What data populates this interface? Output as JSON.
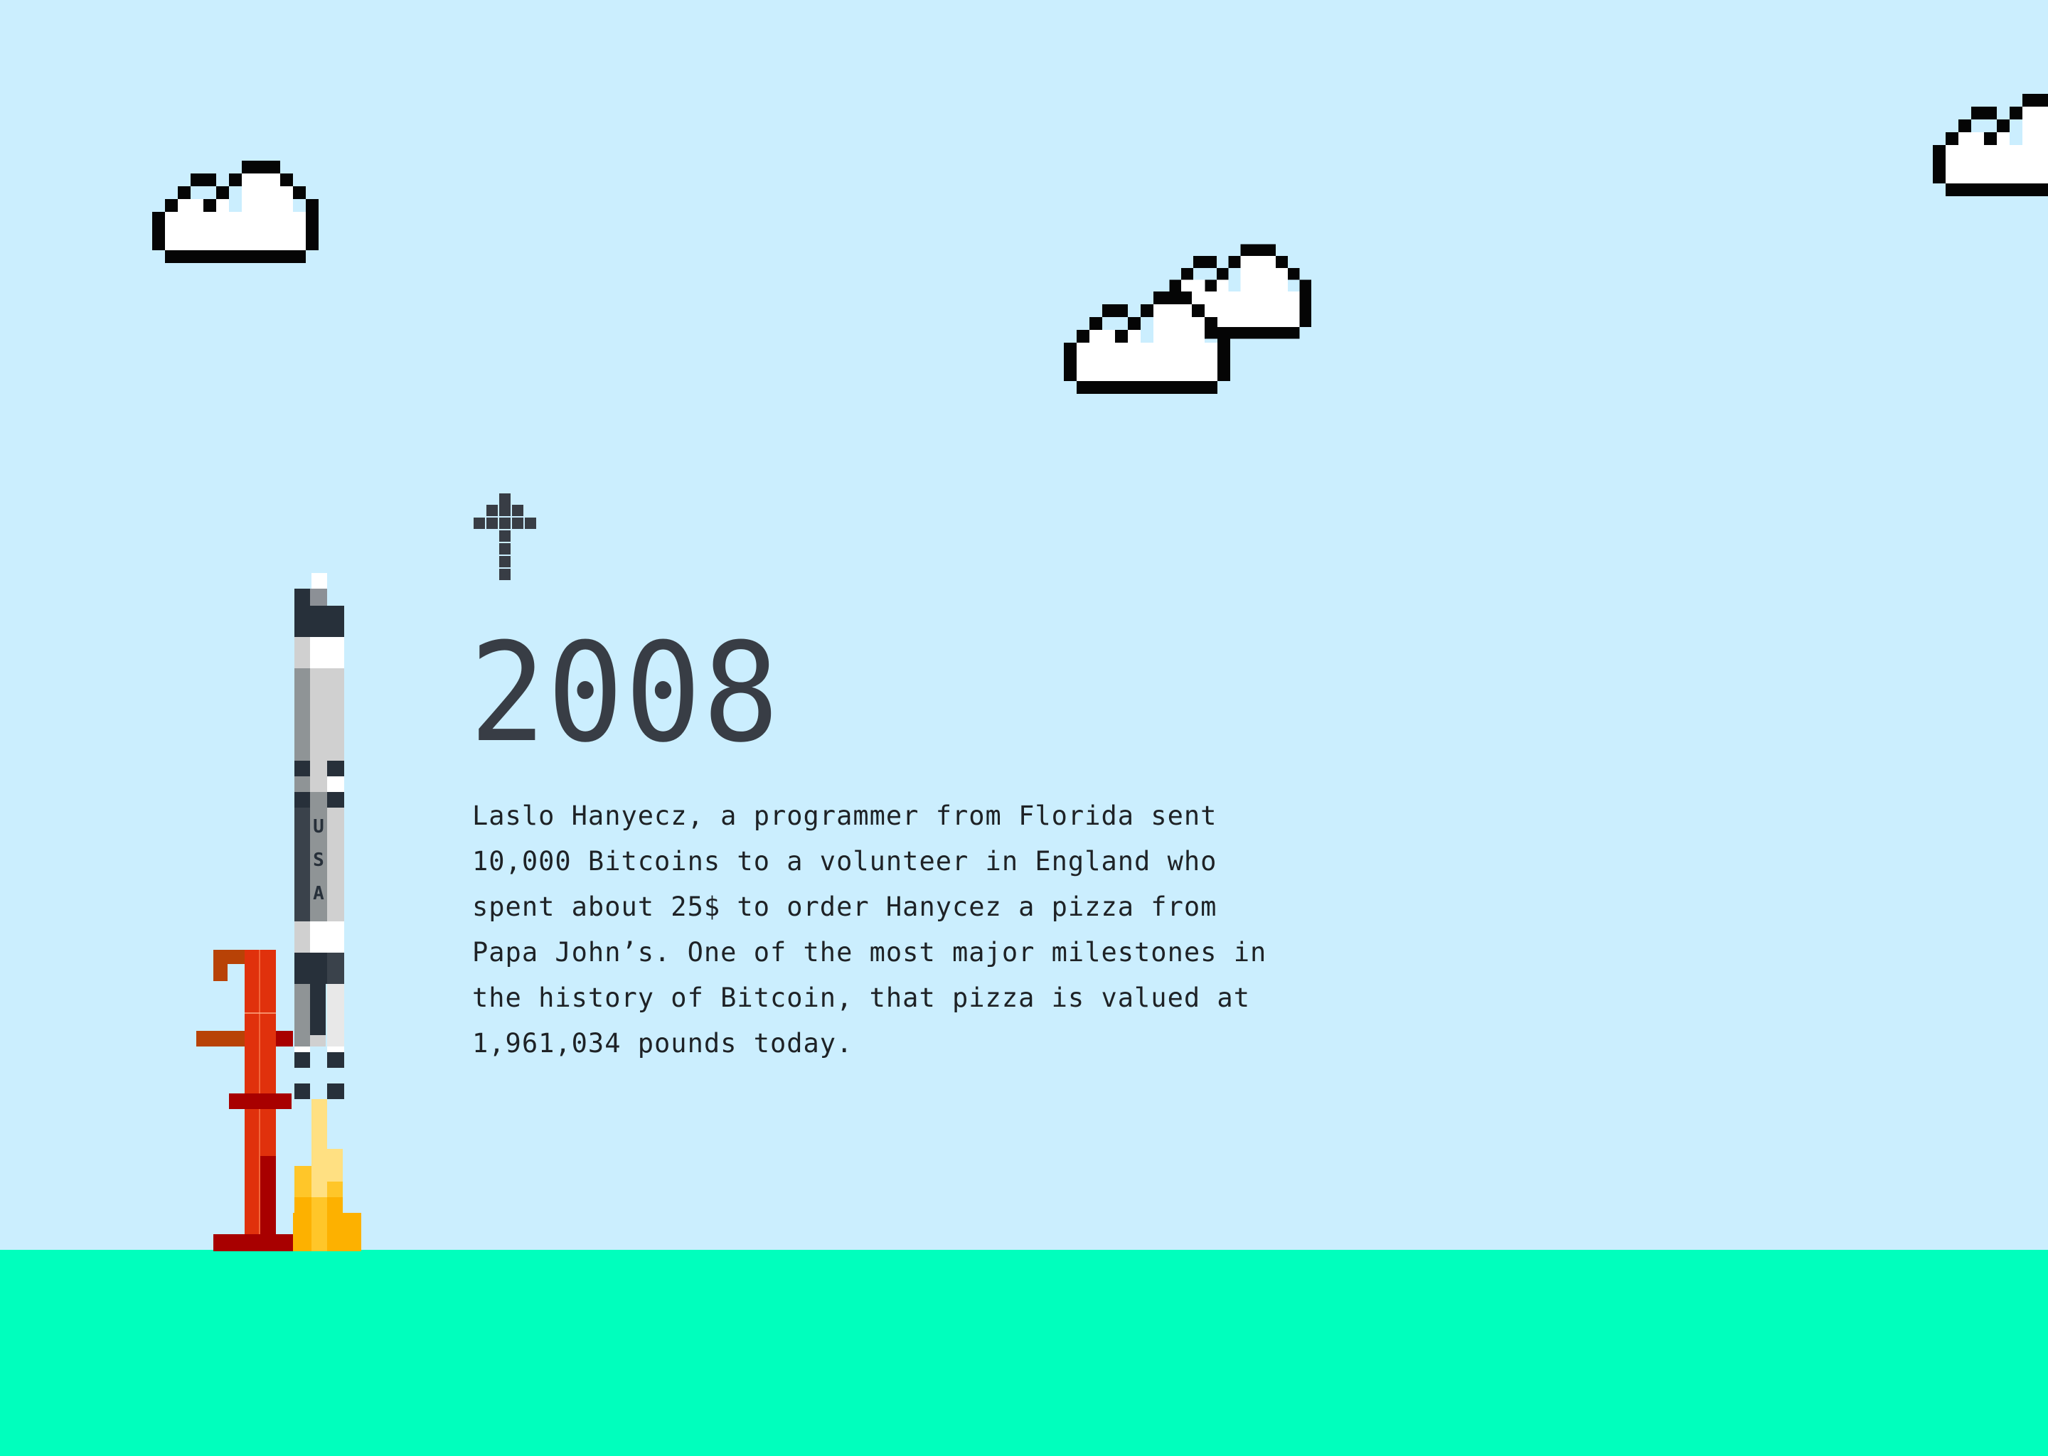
{
  "scene": {
    "colors": {
      "sky": "#cbeefe",
      "ground": "#00ffbd",
      "cloud_outline": "#050505",
      "cloud_fill": "#ffffff",
      "text": "#383d45",
      "rocket_dark": "#27303a",
      "tower_red": "#e0310c",
      "flame": "#fdb100"
    },
    "icons": {
      "scroll_indicator": "up-arrow-icon",
      "rocket": "rocket-icon",
      "launch_tower": "launch-tower-icon",
      "clouds": "pixel-cloud-icon"
    }
  },
  "milestone": {
    "year": "2008",
    "description": "Laslo Hanyecz, a programmer from Florida sent 10,000 Bitcoins to a volunteer in England who spent about 25$ to order Hanycez a pizza from Papa John’s. One of the most major milestones in the history of Bitcoin, that pizza is valued at 1,961,034 pounds today."
  },
  "rocket": {
    "body_lettering": "USA"
  }
}
